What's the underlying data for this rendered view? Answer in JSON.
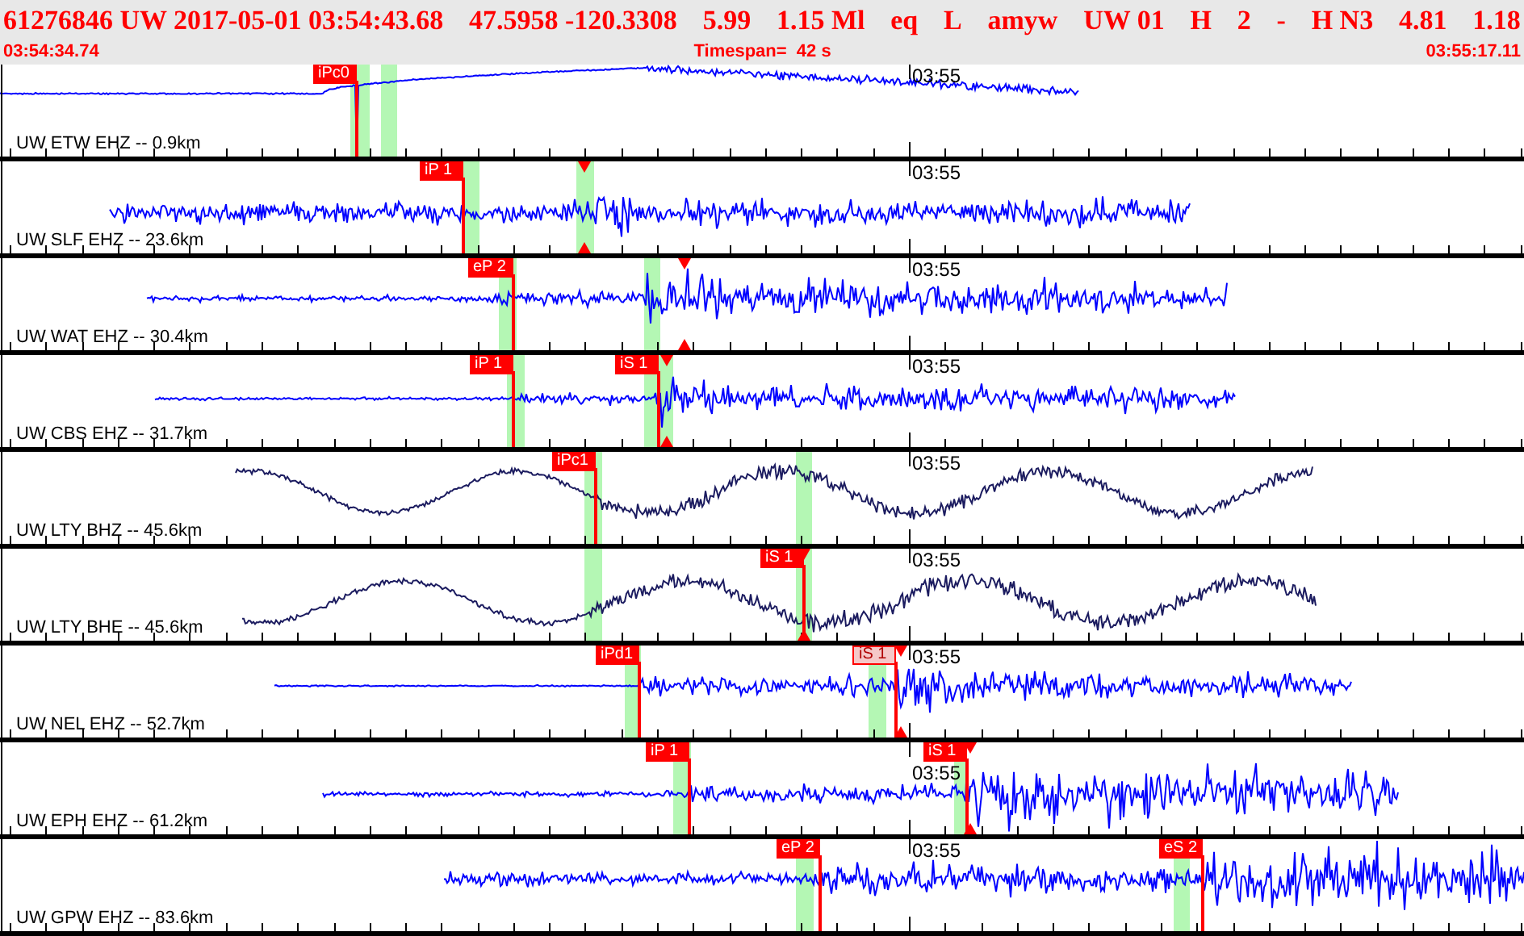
{
  "header": {
    "event_fields": [
      "61276846 UW 2017-05-01 03:54:43.68",
      "47.5958 -120.3308",
      "5.99",
      "1.15 Ml",
      "eq",
      "L",
      "amyw",
      "UW 01",
      "H",
      "2",
      "-",
      "H N3",
      "4.81",
      "1.18"
    ],
    "start_time": "03:54:34.74",
    "timespan": "Timespan=  42 s",
    "end_time": "03:55:17.11"
  },
  "traces": [
    {
      "label": "UW ETW EHZ -- 0.9km",
      "minute_label": "03:55",
      "kind": "short-period",
      "picks": [
        {
          "label": "iPc0",
          "kind": "solid"
        }
      ]
    },
    {
      "label": "UW SLF EHZ -- 23.6km",
      "minute_label": "03:55",
      "kind": "short-period",
      "picks": [
        {
          "label": "iP 1",
          "kind": "solid"
        }
      ]
    },
    {
      "label": "UW WAT EHZ -- 30.4km",
      "minute_label": "03:55",
      "kind": "short-period",
      "picks": [
        {
          "label": "eP 2",
          "kind": "solid"
        }
      ]
    },
    {
      "label": "UW CBS EHZ -- 31.7km",
      "minute_label": "03:55",
      "kind": "short-period",
      "picks": [
        {
          "label": "iP 1",
          "kind": "solid"
        },
        {
          "label": "iS 1",
          "kind": "solid"
        }
      ]
    },
    {
      "label": "UW LTY BHZ -- 45.6km",
      "minute_label": "03:55",
      "kind": "broadband",
      "picks": [
        {
          "label": "iPc1",
          "kind": "solid"
        }
      ]
    },
    {
      "label": "UW LTY BHE -- 45.6km",
      "minute_label": "03:55",
      "kind": "broadband",
      "picks": [
        {
          "label": "iS 1",
          "kind": "solid"
        }
      ]
    },
    {
      "label": "UW NEL EHZ -- 52.7km",
      "minute_label": "03:55",
      "kind": "short-period",
      "picks": [
        {
          "label": "iPd1",
          "kind": "solid"
        },
        {
          "label": "iS 1",
          "kind": "outline"
        }
      ]
    },
    {
      "label": "UW EPH EHZ -- 61.2km",
      "minute_label": "03:55",
      "kind": "short-period",
      "picks": [
        {
          "label": "iP 1",
          "kind": "solid"
        },
        {
          "label": "iS 1",
          "kind": "solid"
        }
      ]
    },
    {
      "label": "UW GPW EHZ -- 83.6km",
      "minute_label": "03:55",
      "kind": "short-period",
      "picks": [
        {
          "label": "eP 2",
          "kind": "solid"
        },
        {
          "label": "eS 2",
          "kind": "solid"
        }
      ]
    }
  ]
}
